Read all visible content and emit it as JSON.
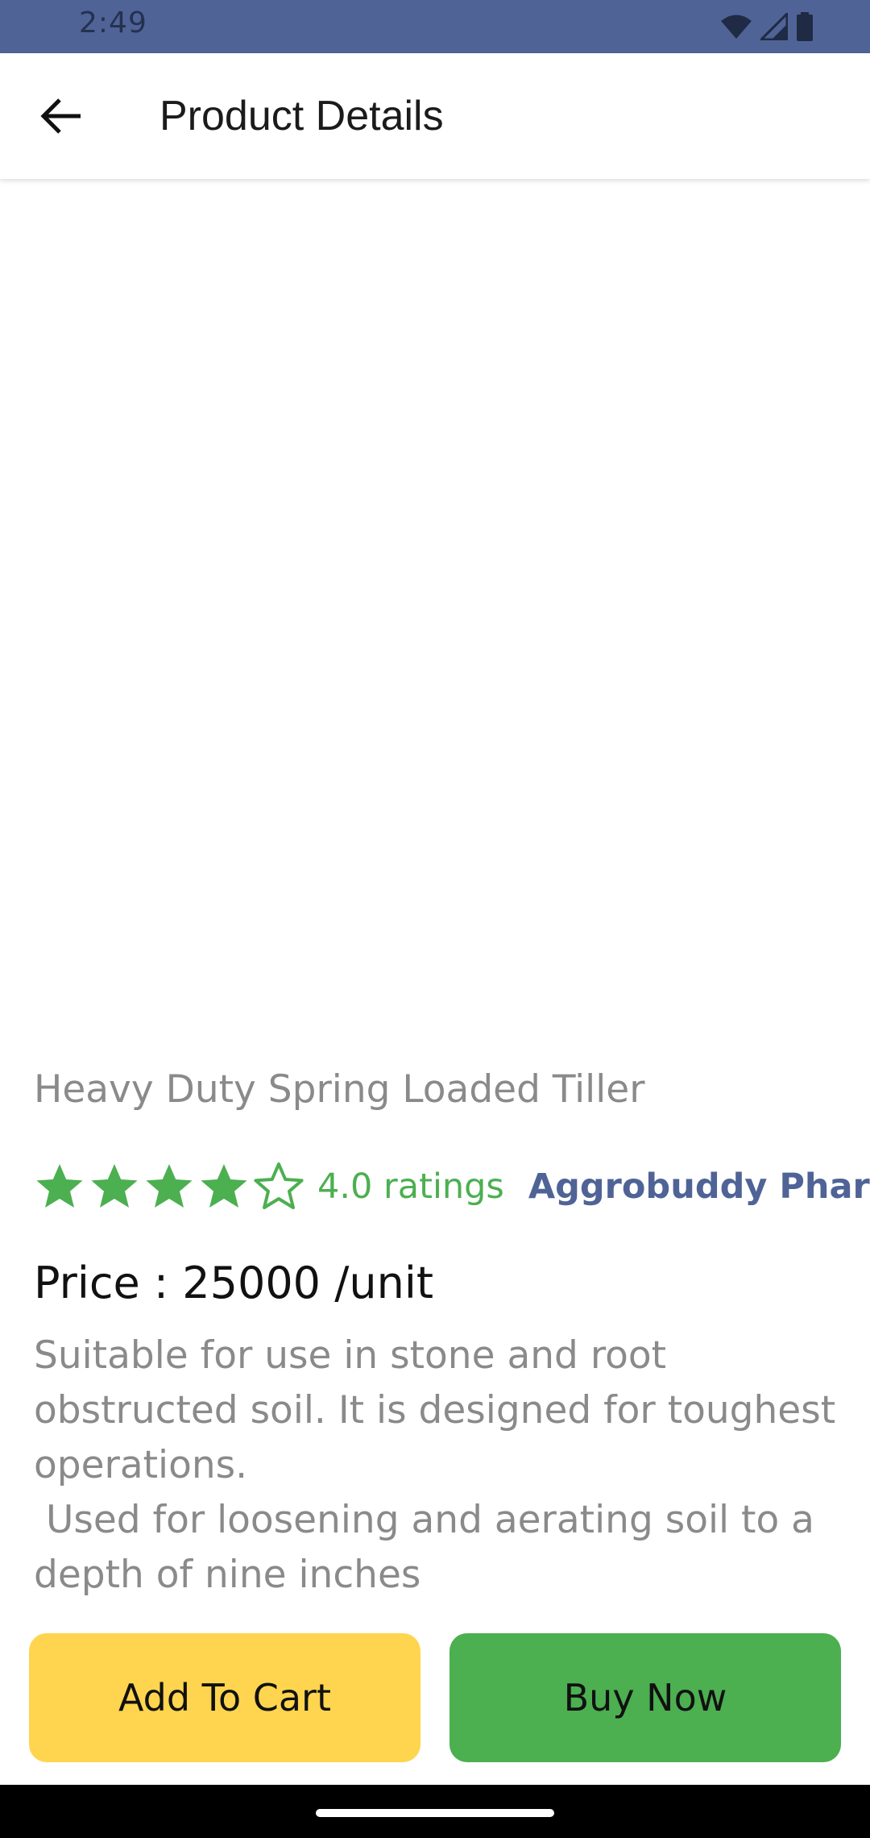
{
  "status_bar": {
    "time": "2:49",
    "icons": [
      "wifi-icon",
      "signal-icon",
      "battery-icon"
    ],
    "color": "#4f6396"
  },
  "app_bar": {
    "back_icon": "arrow-left-icon",
    "title": "Product Details"
  },
  "product": {
    "name": "Heavy Duty Spring Loaded Tiller",
    "rating": 4.0,
    "rating_max": 5,
    "rating_text": "4.0 ratings",
    "seller": "Aggrobuddy Pharma",
    "price": "Price : 25000 /unit",
    "description": "Suitable for use in stone and root obstructed soil. It is designed for toughest operations.\n Used for loosening and aerating soil to a depth of nine inches"
  },
  "actions": {
    "add_to_cart": "Add To Cart",
    "buy_now": "Buy Now"
  },
  "colors": {
    "accent_green": "#4caf50",
    "cart_yellow": "#ffd54f",
    "brand_blue": "#4f6396"
  }
}
